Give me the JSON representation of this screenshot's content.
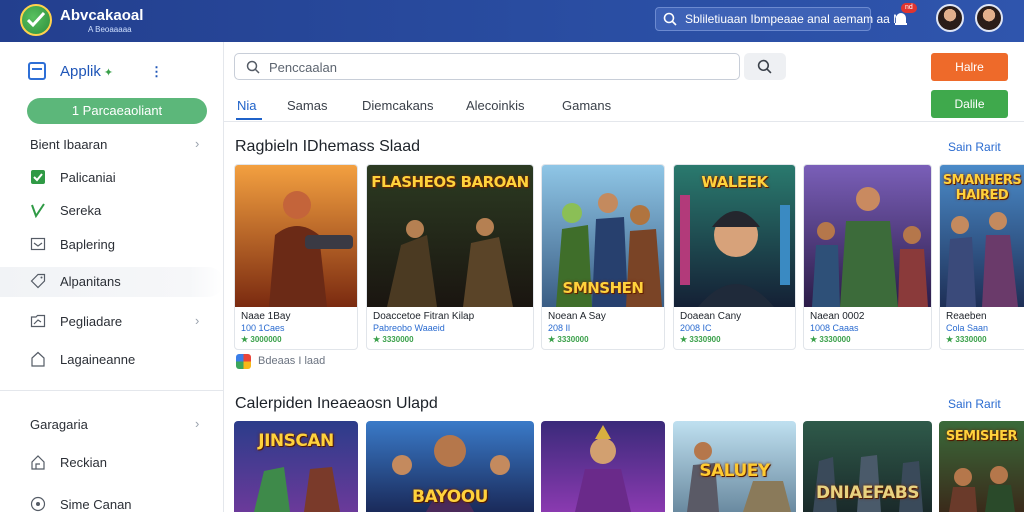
{
  "header": {
    "brand": "Abvcakaoal",
    "brand_sub": "A Beoaaaaa",
    "search_text": "Sbliletiuaan Ibmpeaae anal aemam aa M.",
    "notification_badge": "nd",
    "icons": [
      "logo-icon",
      "search-icon",
      "bell-icon"
    ]
  },
  "sidebar": {
    "app_title": "Applik",
    "cta": "1 Parcaeaoliant",
    "items": [
      {
        "label": "Bient Ibaaran",
        "icon": "",
        "chevron": "›"
      },
      {
        "label": "Palicaniai",
        "icon": "checkbox-icon"
      },
      {
        "label": "Sereka",
        "icon": "check-icon"
      },
      {
        "label": "Baplering",
        "icon": "inbox-icon"
      },
      {
        "label": "Alpanitans",
        "icon": "tag-icon"
      },
      {
        "label": "Pegliadare",
        "icon": "folder-icon",
        "chevron": "›"
      },
      {
        "label": "Lagaineanne",
        "icon": "home-icon"
      },
      {
        "label": "Garagaria",
        "icon": "",
        "chevron": "›"
      },
      {
        "label": "Reckian",
        "icon": "house-icon"
      },
      {
        "label": "Sime Canan",
        "icon": "pin-icon"
      }
    ]
  },
  "main": {
    "search_placeholder": "Penccaalan",
    "btn_orange": "Halre",
    "btn_green": "Dalile",
    "tabs": [
      "Nia",
      "Samas",
      "Diemcakans",
      "Alecoinkis",
      "Gamans"
    ],
    "section1_title": "Ragbieln IDhemass Slaad",
    "section2_title": "Calerpiden Ineaeaosn Ulapd",
    "see_all": "Sain Rarit",
    "source_text": "Bdeaas I laad",
    "cards": [
      {
        "art": "",
        "title": "Naae 1Bay",
        "meta": "100 1Caes",
        "price": "★ 3000000"
      },
      {
        "art": "FLASHEOS BAROAN",
        "title": "Doaccetoe Fitran Kilap",
        "meta": "Pabreobo Waaeid",
        "price": "★ 3330000"
      },
      {
        "art": "SMNSHEN",
        "title": "Noean A Say",
        "meta": "208 Il",
        "price": "★ 3330000"
      },
      {
        "art": "WALEEK",
        "title": "Doaean Cany",
        "meta": "2008 IC",
        "price": "★ 3330900"
      },
      {
        "art": "",
        "title": "Naean 0002",
        "meta": "1008 Caaas",
        "price": "★ 3330000"
      },
      {
        "art": "SMANHERS HAIRED",
        "title": "Reaeben",
        "meta": "Cola Saan",
        "price": "★ 3330000"
      }
    ],
    "cards2": [
      {
        "art": "JINSCAN"
      },
      {
        "art": "BAYOOU"
      },
      {
        "art": ""
      },
      {
        "art": "SALUEY"
      },
      {
        "art": "DNIAEFABS"
      },
      {
        "art": "SEMISHER"
      }
    ]
  },
  "colors": {
    "topbar": "#2a4ea3",
    "accent_blue": "#1f62c9",
    "cta_green": "#5cb77a",
    "btn_orange": "#ee6a2a",
    "btn_green": "#3fa94c"
  }
}
